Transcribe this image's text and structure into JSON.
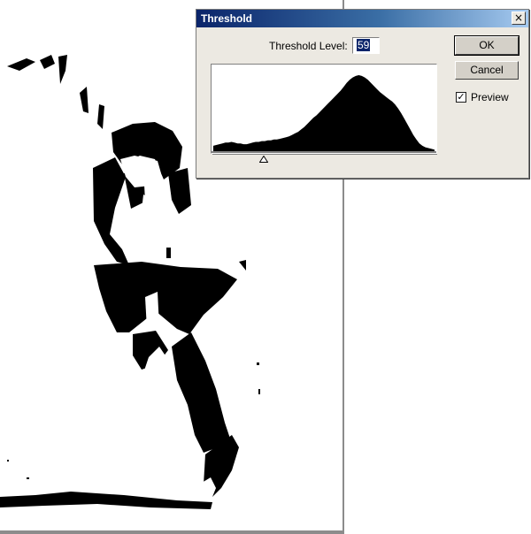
{
  "dialog": {
    "title": "Threshold",
    "close_glyph": "×",
    "threshold_label": "Threshold Level:",
    "threshold_value": "59",
    "ok_label": "OK",
    "cancel_label": "Cancel",
    "preview_label": "Preview",
    "preview_checked": true,
    "check_glyph": "✓"
  },
  "slider": {
    "min": 1,
    "max": 255,
    "value": 59
  },
  "histogram": {
    "bins": [
      7,
      8,
      9,
      10,
      11,
      11,
      12,
      11,
      10,
      10,
      9,
      9,
      10,
      11,
      12,
      12,
      13,
      13,
      14,
      14,
      15,
      15,
      16,
      17,
      18,
      19,
      21,
      23,
      25,
      28,
      31,
      35,
      39,
      43,
      46,
      50,
      54,
      58,
      62,
      66,
      70,
      74,
      78,
      83,
      88,
      92,
      95,
      97,
      98,
      97,
      95,
      92,
      88,
      84,
      80,
      76,
      73,
      70,
      67,
      64,
      60,
      55,
      49,
      42,
      35,
      28,
      21,
      15,
      10,
      7,
      5,
      4,
      3,
      2
    ]
  },
  "colors": {
    "dialog_bg": "#ece9e2",
    "title_start": "#0a246a",
    "title_end": "#a6caf0",
    "selection": "#0a246a"
  }
}
